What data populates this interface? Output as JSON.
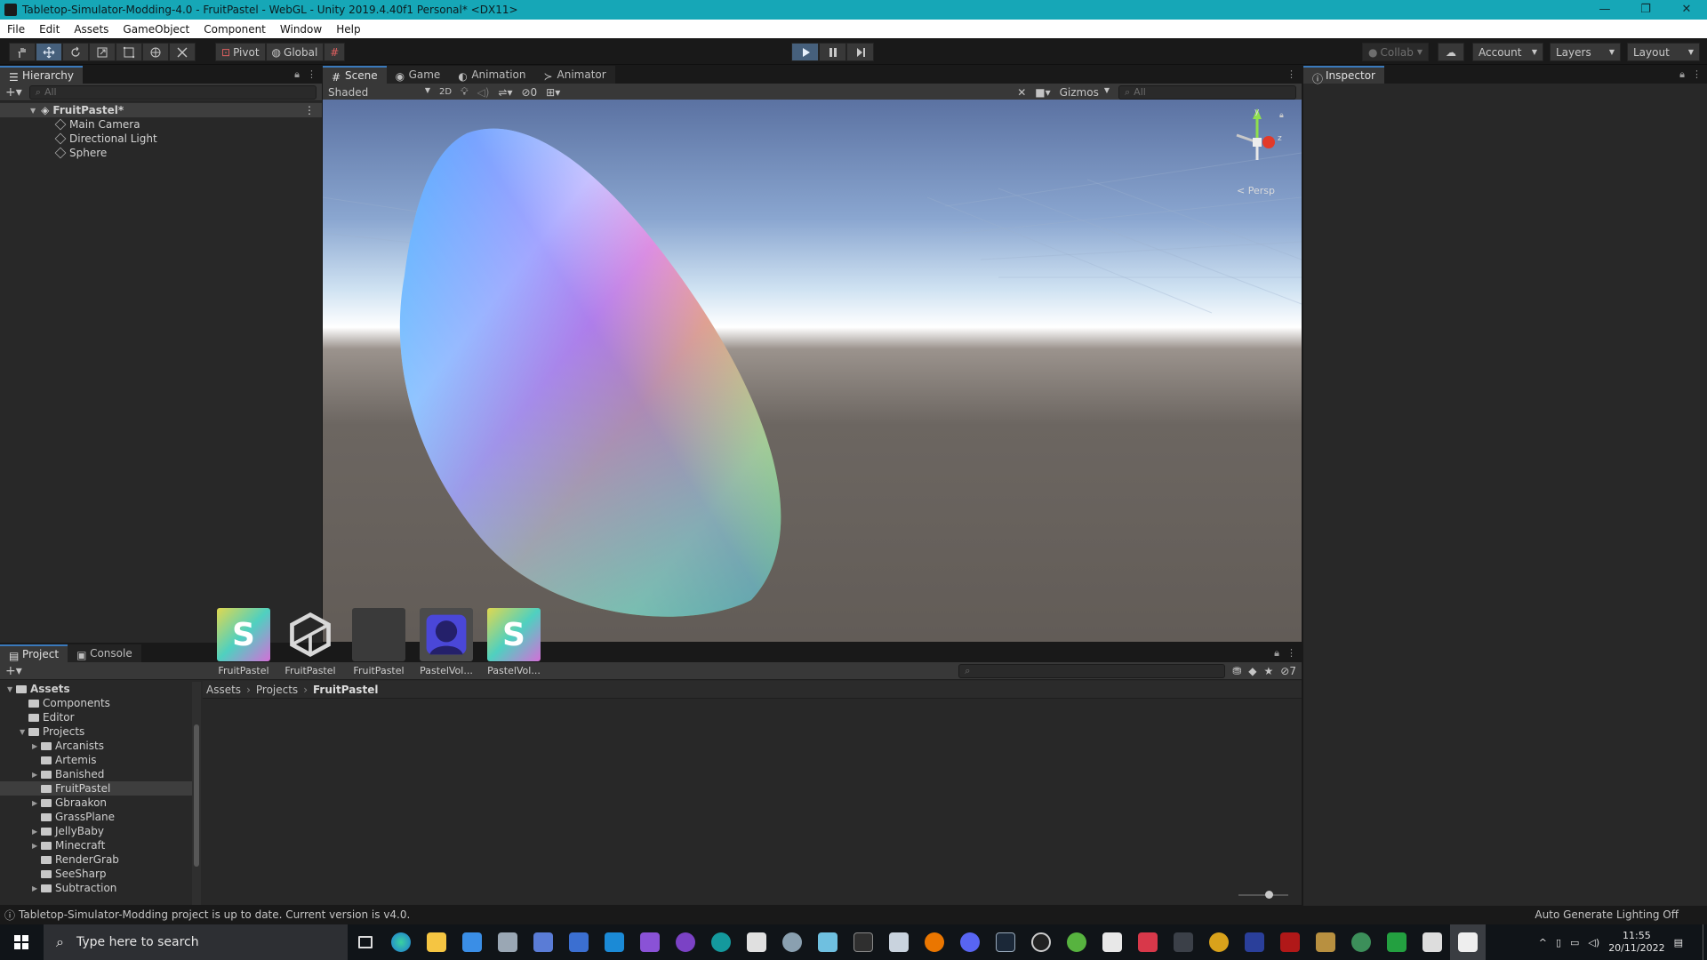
{
  "window": {
    "title": "Tabletop-Simulator-Modding-4.0 - FruitPastel - WebGL - Unity 2019.4.40f1 Personal* <DX11>",
    "controls": [
      "—",
      "❐",
      "✕"
    ]
  },
  "menu": [
    "File",
    "Edit",
    "Assets",
    "GameObject",
    "Component",
    "Window",
    "Help"
  ],
  "toolbar": {
    "pivot_label": "Pivot",
    "global_label": "Global",
    "collab_label": "Collab",
    "account_label": "Account",
    "layers_label": "Layers",
    "layout_label": "Layout"
  },
  "hierarchy": {
    "tab_label": "Hierarchy",
    "search_placeholder": "All",
    "scene_name": "FruitPastel*",
    "items": [
      "Main Camera",
      "Directional Light",
      "Sphere"
    ]
  },
  "scene": {
    "tabs": [
      "Scene",
      "Game",
      "Animation",
      "Animator"
    ],
    "shading_mode": "Shaded",
    "mode_2d": "2D",
    "hidden_count": "0",
    "gizmos_label": "Gizmos",
    "search_placeholder": "All",
    "projection_label": "< Persp",
    "axis_labels": {
      "y": "y",
      "z": "z"
    }
  },
  "inspector": {
    "tab_label": "Inspector"
  },
  "project": {
    "tabs": [
      "Project",
      "Console"
    ],
    "hidden_count": "7",
    "breadcrumb": [
      "Assets",
      "Projects",
      "FruitPastel"
    ],
    "tree": [
      {
        "label": "Assets",
        "level": 0,
        "arrow": "▼",
        "bold": true
      },
      {
        "label": "Components",
        "level": 1,
        "arrow": ""
      },
      {
        "label": "Editor",
        "level": 1,
        "arrow": ""
      },
      {
        "label": "Projects",
        "level": 1,
        "arrow": "▼"
      },
      {
        "label": "Arcanists",
        "level": 2,
        "arrow": "▶"
      },
      {
        "label": "Artemis",
        "level": 2,
        "arrow": ""
      },
      {
        "label": "Banished",
        "level": 2,
        "arrow": "▶"
      },
      {
        "label": "FruitPastel",
        "level": 2,
        "arrow": "",
        "selected": true
      },
      {
        "label": "Gbraakon",
        "level": 2,
        "arrow": "▶"
      },
      {
        "label": "GrassPlane",
        "level": 2,
        "arrow": ""
      },
      {
        "label": "JellyBaby",
        "level": 2,
        "arrow": "▶"
      },
      {
        "label": "Minecraft",
        "level": 2,
        "arrow": "▶"
      },
      {
        "label": "RenderGrab",
        "level": 2,
        "arrow": ""
      },
      {
        "label": "SeeSharp",
        "level": 2,
        "arrow": ""
      },
      {
        "label": "Subtraction",
        "level": 2,
        "arrow": "▶"
      }
    ],
    "assets": [
      {
        "label": "FruitPastel",
        "icon": "shader-icon"
      },
      {
        "label": "FruitPastel",
        "icon": "unity-scene-icon"
      },
      {
        "label": "FruitPastel",
        "icon": "material-icon"
      },
      {
        "label": "PastelVol...",
        "icon": "volume-profile-icon"
      },
      {
        "label": "PastelVol...",
        "icon": "shader-icon"
      }
    ]
  },
  "status": {
    "message": "Tabletop-Simulator-Modding project is up to date. Current version is v4.0.",
    "lighting": "Auto Generate Lighting Off"
  },
  "taskbar": {
    "search_placeholder": "Type here to search",
    "time": "11:55",
    "date": "20/11/2022"
  }
}
